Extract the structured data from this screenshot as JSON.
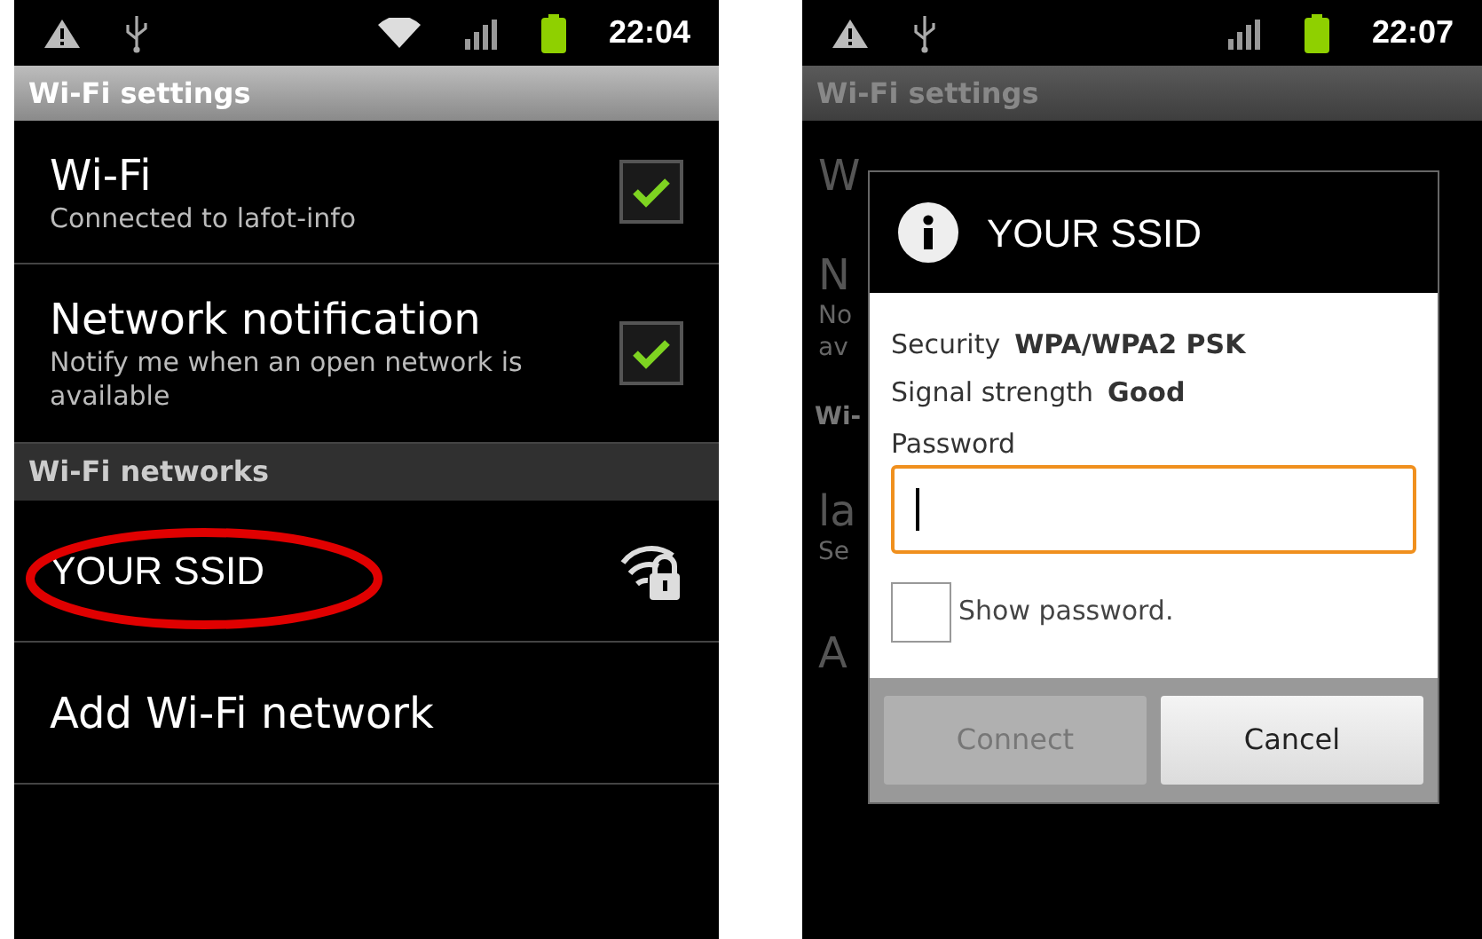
{
  "left_screen": {
    "status_bar": {
      "time": "22:04",
      "wifi_connected": true
    },
    "header": "Wi-Fi settings",
    "settings": [
      {
        "title": "Wi-Fi",
        "summary": "Connected to lafot-info",
        "checked": true
      },
      {
        "title": "Network notification",
        "summary": "Notify me when an open network is available",
        "checked": true
      }
    ],
    "networks_header": "Wi-Fi networks",
    "networks": [
      {
        "kind": "network",
        "name": "YOUR SSID",
        "secured": true,
        "circled": true
      },
      {
        "kind": "action",
        "name": "Add Wi-Fi network"
      }
    ]
  },
  "right_screen": {
    "status_bar": {
      "time": "22:07",
      "wifi_connected": false
    },
    "header": "Wi-Fi settings",
    "background_fragments": [
      {
        "kind": "title",
        "text": "W"
      },
      {
        "kind": "title",
        "text": "N"
      },
      {
        "kind": "summary",
        "text": "No"
      },
      {
        "kind": "summary",
        "text": "av"
      },
      {
        "kind": "section",
        "text": "Wi-"
      },
      {
        "kind": "title",
        "text": "la"
      },
      {
        "kind": "summary",
        "text": "Se"
      },
      {
        "kind": "title",
        "text": "A"
      }
    ],
    "dialog": {
      "title": "YOUR SSID",
      "info": [
        {
          "label": "Security",
          "value": "WPA/WPA2 PSK"
        },
        {
          "label": "Signal strength",
          "value": "Good"
        }
      ],
      "password_label": "Password",
      "password_focused": true,
      "show_password": {
        "label": "Show password.",
        "checked": false
      },
      "buttons": [
        {
          "label": "Connect",
          "disabled": true
        },
        {
          "label": "Cancel",
          "disabled": false
        }
      ]
    }
  }
}
